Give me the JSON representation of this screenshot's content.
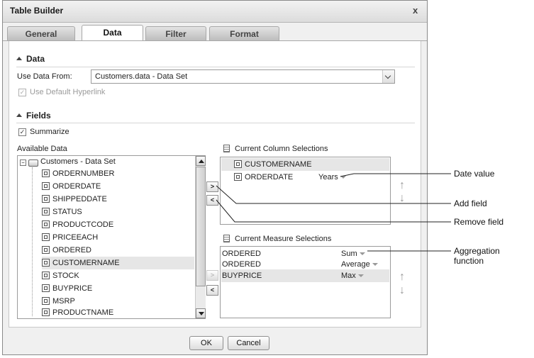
{
  "dialog": {
    "title": "Table Builder",
    "close": "x"
  },
  "tabs": [
    {
      "label": "General"
    },
    {
      "label": "Data"
    },
    {
      "label": "Filter"
    },
    {
      "label": "Format"
    }
  ],
  "data_section": {
    "header": "Data",
    "use_data_from_label": "Use Data From:",
    "use_data_from_value": "Customers.data - Data Set",
    "use_default_hyperlink": "Use Default Hyperlink"
  },
  "fields_section": {
    "header": "Fields",
    "summarize": "Summarize",
    "available_label": "Available Data",
    "tree_root": "Customers - Data Set",
    "available_fields": [
      "ORDERNUMBER",
      "ORDERDATE",
      "SHIPPEDDATE",
      "STATUS",
      "PRODUCTCODE",
      "PRICEEACH",
      "ORDERED",
      "CUSTOMERNAME",
      "STOCK",
      "BUYPRICE",
      "MSRP",
      "PRODUCTNAME"
    ],
    "selected_available": "CUSTOMERNAME"
  },
  "column_selections": {
    "label": "Current Column Selections",
    "items": [
      {
        "name": "CUSTOMERNAME",
        "option": ""
      },
      {
        "name": "ORDERDATE",
        "option": "Years"
      }
    ]
  },
  "measure_selections": {
    "label": "Current Measure Selections",
    "items": [
      {
        "name": "ORDERED",
        "agg": "Sum"
      },
      {
        "name": "ORDERED",
        "agg": "Average"
      },
      {
        "name": "BUYPRICE",
        "agg": "Max"
      }
    ]
  },
  "buttons": {
    "add": ">",
    "remove": "<",
    "ok": "OK",
    "cancel": "Cancel"
  },
  "callouts": {
    "date_value": "Date value",
    "add_field": "Add field",
    "remove_field": "Remove field",
    "aggregation_1": "Aggregation",
    "aggregation_2": "function"
  },
  "icons": {
    "move_up": "↑",
    "move_down": "↓"
  }
}
